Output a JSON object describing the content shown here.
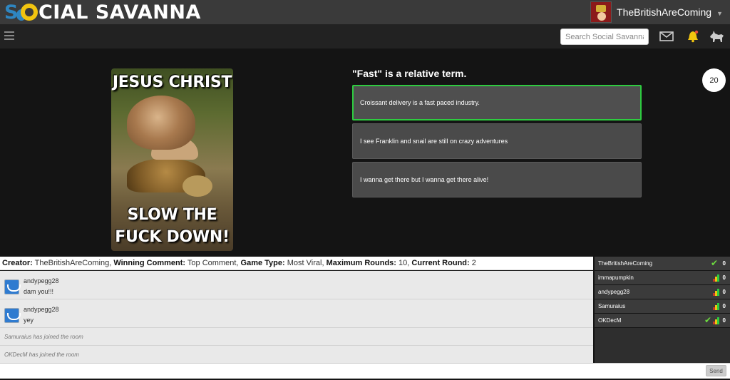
{
  "app": {
    "logo_text_a": "S",
    "logo_text_b": "CIAL SAVANNA"
  },
  "header": {
    "username": "TheBritishAreComing",
    "caret": "▼"
  },
  "nav": {
    "search_placeholder": "Search Social Savanna",
    "icons": [
      "menu-icon",
      "mail-icon",
      "bell-icon",
      "cat-icon"
    ]
  },
  "meme": {
    "top_text": "JESUS CHRIST",
    "bottom_text": "SLOW THE FUCK DOWN!"
  },
  "caption": {
    "title": "\"Fast\" is a relative term.",
    "options": [
      "Croissant delivery is a fast paced industry.",
      "I see Franklin and snail are still on crazy adventures",
      "I wanna get there but I wanna get there alive!"
    ],
    "selected_index": 0
  },
  "round_counter": "20",
  "game_info": {
    "creator_label": "Creator:",
    "creator": "TheBritishAreComing",
    "winning_label": "Winning Comment:",
    "winning": "Top Comment",
    "type_label": "Game Type:",
    "type": "Most Viral",
    "max_label": "Maximum Rounds:",
    "max": "10",
    "current_label": "Current Round:",
    "current": "2"
  },
  "chat": {
    "messages": [
      {
        "user": "andypegg28",
        "text": "dam you!!!"
      },
      {
        "user": "andypegg28",
        "text": "yey"
      }
    ],
    "system": [
      "Samuraius has joined the room",
      "OKDecM has joined the room"
    ],
    "send_label": "Send"
  },
  "players": [
    {
      "name": "TheBritishAreComing",
      "score": "0",
      "check": true,
      "bars": false
    },
    {
      "name": "immapumpkin",
      "score": "0",
      "check": false,
      "bars": true
    },
    {
      "name": "andypegg28",
      "score": "0",
      "check": false,
      "bars": true
    },
    {
      "name": "Samuraius",
      "score": "0",
      "check": false,
      "bars": true
    },
    {
      "name": "OKDecM",
      "score": "0",
      "check": true,
      "bars": true
    }
  ],
  "colors": {
    "accent_green": "#2ecc40",
    "logo_yellow": "#f1c40f",
    "logo_blue": "#2e86c1",
    "bell_yellow": "#f1c40f"
  }
}
